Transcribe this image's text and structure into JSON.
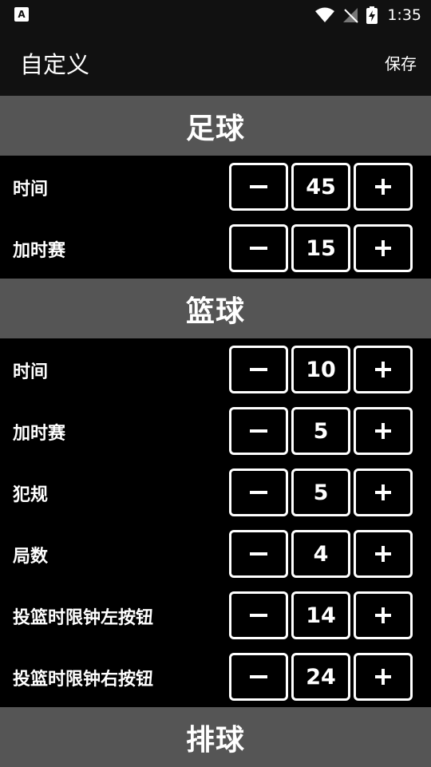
{
  "status_bar": {
    "time": "1:35",
    "icons": [
      "notification-a-icon",
      "wifi-icon",
      "no-signal-icon",
      "battery-charging-icon"
    ]
  },
  "app_bar": {
    "title": "自定义",
    "save_label": "保存"
  },
  "sections": [
    {
      "title": "足球",
      "rows": [
        {
          "label": "时间",
          "value": "45"
        },
        {
          "label": "加时赛",
          "value": "15"
        }
      ]
    },
    {
      "title": "篮球",
      "rows": [
        {
          "label": "时间",
          "value": "10"
        },
        {
          "label": "加时赛",
          "value": "5"
        },
        {
          "label": "犯规",
          "value": "5"
        },
        {
          "label": "局数",
          "value": "4"
        },
        {
          "label": "投篮时限钟左按钮",
          "value": "14"
        },
        {
          "label": "投篮时限钟右按钮",
          "value": "24"
        }
      ]
    },
    {
      "title": "排球",
      "rows": []
    }
  ],
  "colors": {
    "background": "#000000",
    "section_header": "#555555",
    "bar": "#111111",
    "text": "#ffffff"
  }
}
